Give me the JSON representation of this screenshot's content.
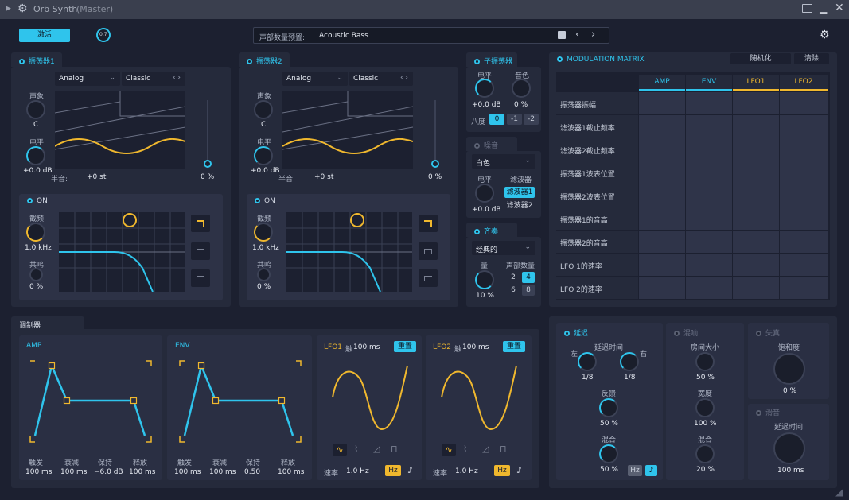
{
  "titlebar": {
    "title": "Orb Synth",
    "subtitle": "(Master)"
  },
  "top": {
    "activate": "激活",
    "knob_value": "0.7",
    "preset_label": "声部数量预置:",
    "preset_name": "Acoustic Bass"
  },
  "osc1": {
    "title": "振荡器1",
    "wave": "Analog",
    "type": "Classic",
    "pan_label": "声象",
    "pan_value": "C",
    "level_label": "电平",
    "level_value": "+0.0 dB",
    "semi_label": "半音:",
    "semi_value": "+0 st",
    "slider_value": "0 %"
  },
  "osc2": {
    "title": "振荡器2",
    "wave": "Analog",
    "type": "Classic",
    "pan_label": "声象",
    "pan_value": "C",
    "level_label": "电平",
    "level_value": "+0.0 dB",
    "semi_label": "半音:",
    "semi_value": "+0 st",
    "slider_value": "0 %"
  },
  "filter1": {
    "on": "ON",
    "cutoff_label": "截频",
    "cutoff_value": "1.0 kHz",
    "res_label": "共鸣",
    "res_value": "0 %"
  },
  "filter2": {
    "on": "ON",
    "cutoff_label": "截频",
    "cutoff_value": "1.0 kHz",
    "res_label": "共鸣",
    "res_value": "0 %"
  },
  "subosc": {
    "title": "子振荡器",
    "level_label": "电平",
    "level_value": "+0.0 dB",
    "tone_label": "音色",
    "tone_value": "0 %",
    "octave_label": "八度",
    "octaves": [
      "0",
      "-1",
      "-2"
    ]
  },
  "noise": {
    "title": "噪音",
    "color": "白色",
    "level_label": "电平",
    "level_value": "+0.0 dB",
    "filter_label": "滤波器",
    "filters": [
      "滤波器1",
      "滤波器2"
    ]
  },
  "unison": {
    "title": "齐奏",
    "mode": "经典的",
    "amount_label": "量",
    "amount_value": "10 %",
    "voices_label": "声部数量",
    "voices": [
      "2",
      "4",
      "6",
      "8"
    ]
  },
  "matrix": {
    "title": "MODULATION MATRIX",
    "randomize": "随机化",
    "clear": "清除",
    "columns": [
      "AMP",
      "ENV",
      "LFO1",
      "LFO2"
    ],
    "rows": [
      "振荡器振幅",
      "滤波器1截止频率",
      "滤波器2截止频率",
      "振荡器1波表位置",
      "振荡器2波表位置",
      "振荡器1的音高",
      "振荡器2的音高",
      "LFO 1的速率",
      "LFO 2的速率"
    ]
  },
  "modulator": {
    "title": "调制器"
  },
  "amp": {
    "title": "AMP",
    "labels": [
      "触发",
      "衰减",
      "保持",
      "释放"
    ],
    "values": [
      "100 ms",
      "100 ms",
      "−6.0 dB",
      "100 ms"
    ]
  },
  "env": {
    "title": "ENV",
    "labels": [
      "触发",
      "衰减",
      "保持",
      "释放"
    ],
    "values": [
      "100 ms",
      "100 ms",
      "0.50",
      "100 ms"
    ]
  },
  "lfo1": {
    "title": "LFO1",
    "delay_label": "触",
    "delay_value": "100 ms",
    "reset": "重置",
    "rate_label": "速率",
    "rate_value": "1.0 Hz",
    "hz": "Hz"
  },
  "lfo2": {
    "title": "LFO2",
    "delay_label": "触",
    "delay_value": "100 ms",
    "reset": "重置",
    "rate_label": "速率",
    "rate_value": "1.0 Hz",
    "hz": "Hz"
  },
  "delay": {
    "title": "延迟",
    "time_label": "延迟时间",
    "left_label": "左",
    "right_label": "右",
    "left_value": "1/8",
    "right_value": "1/8",
    "feedback_label": "反馈",
    "feedback_value": "50 %",
    "mix_label": "混合",
    "mix_value": "50 %",
    "hz": "Hz"
  },
  "reverb": {
    "title": "混响",
    "size_label": "房间大小",
    "size_value": "50 %",
    "width_label": "宽度",
    "width_value": "100 %",
    "mix_label": "混合",
    "mix_value": "20 %"
  },
  "distortion": {
    "title": "失真",
    "sat_label": "饱和度",
    "sat_value": "0 %"
  },
  "chorus": {
    "title": "滑音",
    "time_label": "延迟时间",
    "time_value": "100 ms"
  },
  "colors": {
    "accent": "#2fc4ec",
    "lfo": "#f0b82e",
    "bg": "#1c2030",
    "panel": "#252a3b"
  }
}
